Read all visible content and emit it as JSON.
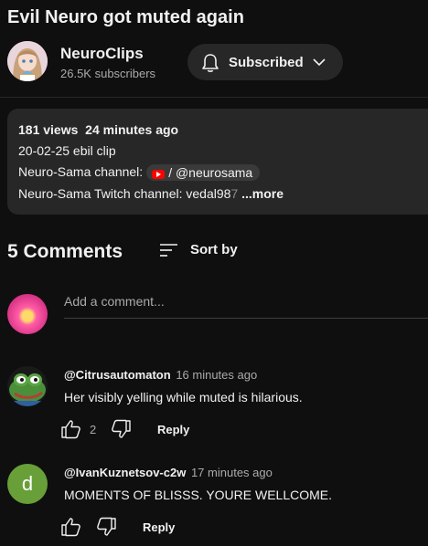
{
  "video": {
    "title": "Evil Neuro got muted again"
  },
  "channel": {
    "name": "NeuroClips",
    "subscribers": "26.5K subscribers",
    "subscribe_label": "Subscribed"
  },
  "description": {
    "views": "181 views",
    "age": "24 minutes ago",
    "line1": "20-02-25 ebil clip",
    "line2_label": "Neuro-Sama channel:",
    "line2_link": "/ @neurosama",
    "line3_label": "Neuro-Sama Twitch channel: vedal98",
    "line3_faded": "7",
    "more_label": "...more"
  },
  "comments_section": {
    "count_label": "5 Comments",
    "sort_label": "Sort by",
    "add_placeholder": "Add a comment..."
  },
  "comments": [
    {
      "author": "@Citrusautomaton",
      "time": "16 minutes ago",
      "text": "Her visibly yelling while muted is hilarious.",
      "likes": "2",
      "reply_label": "Reply",
      "avatar": "pepe-frog-avatar"
    },
    {
      "author": "@IvanKuznetsov-c2w",
      "time": "17 minutes ago",
      "text": "MOMENTS OF BLISSS. YOURE WELLCOME.",
      "likes": "",
      "reply_label": "Reply",
      "avatar_letter": "d",
      "avatar_color": "#689f38"
    }
  ],
  "icons": {
    "bell": "bell-icon",
    "chevron": "chevron-down-icon",
    "sort": "sort-icon",
    "like": "thumbs-up-icon",
    "dislike": "thumbs-down-icon",
    "youtube": "youtube-logo-icon"
  },
  "colors": {
    "background": "#0f0f0f",
    "surface": "#272727",
    "text": "#f1f1f1",
    "secondary_text": "#aaaaaa"
  }
}
